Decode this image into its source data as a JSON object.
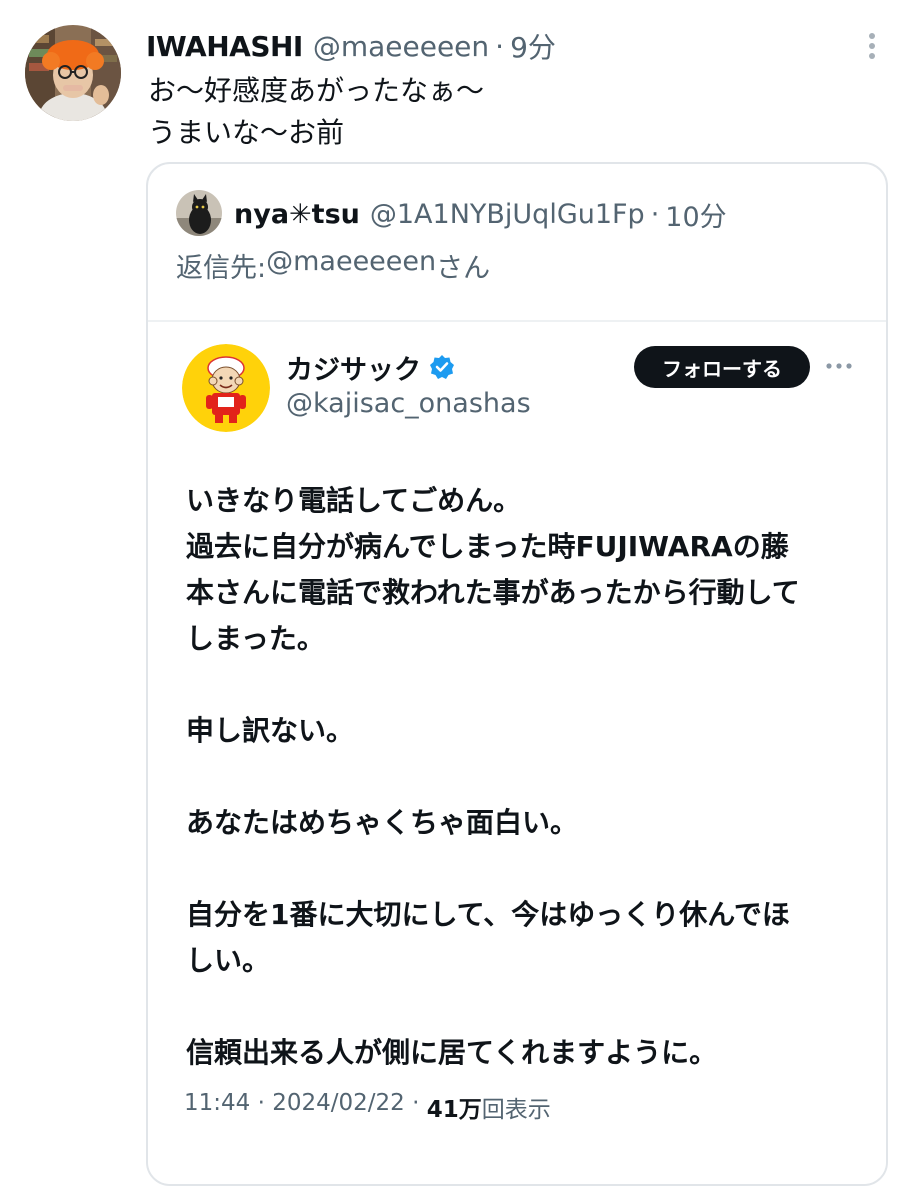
{
  "outer_tweet": {
    "name": "IWAHASHI",
    "handle": "@maeeeeen",
    "separator": "·",
    "time": "9分",
    "text_lines": [
      "お〜好感度あがったなぁ〜",
      "うまいな〜お前"
    ],
    "avatar_icon": "user-avatar-photo",
    "menu_icon": "more-vertical-icon"
  },
  "quote_tweet": {
    "name": "nya✳︎tsu",
    "handle": "@1A1NYBjUqlGu1Fp",
    "separator": "·",
    "time": "10分",
    "reply_prefix": "返信先: ",
    "reply_handle": "@maeeeeen",
    "reply_suffix": "さん",
    "avatar_icon": "cat-avatar-photo"
  },
  "embedded_post": {
    "name": "カジサック",
    "handle": "@kajisac_onashas",
    "verified_icon": "verified-badge-icon",
    "follow_label": "フォローする",
    "menu_icon": "more-horizontal-icon",
    "paragraphs": [
      [
        "いきなり電話してごめん。",
        "過去に自分が病んでしまった時FUJIWARAの藤",
        "本さんに電話で救われた事があったから行動して",
        "しまった。"
      ],
      [
        "申し訳ない。"
      ],
      [
        "あなたはめちゃくちゃ面白い。"
      ],
      [
        "自分を1番に大切にして、今はゆっくり休んでほ",
        "しい。"
      ],
      [
        "信頼出来る人が側に居てくれますように。"
      ]
    ],
    "footer": {
      "time": "11:44",
      "sep1": " · ",
      "date": "2024/02/22",
      "sep2": " · ",
      "views_count": "41万",
      "views_label": "回表示"
    },
    "colors": {
      "verified": "#1d9bf0",
      "follow_bg": "#0f1419",
      "muted": "#536471"
    }
  }
}
